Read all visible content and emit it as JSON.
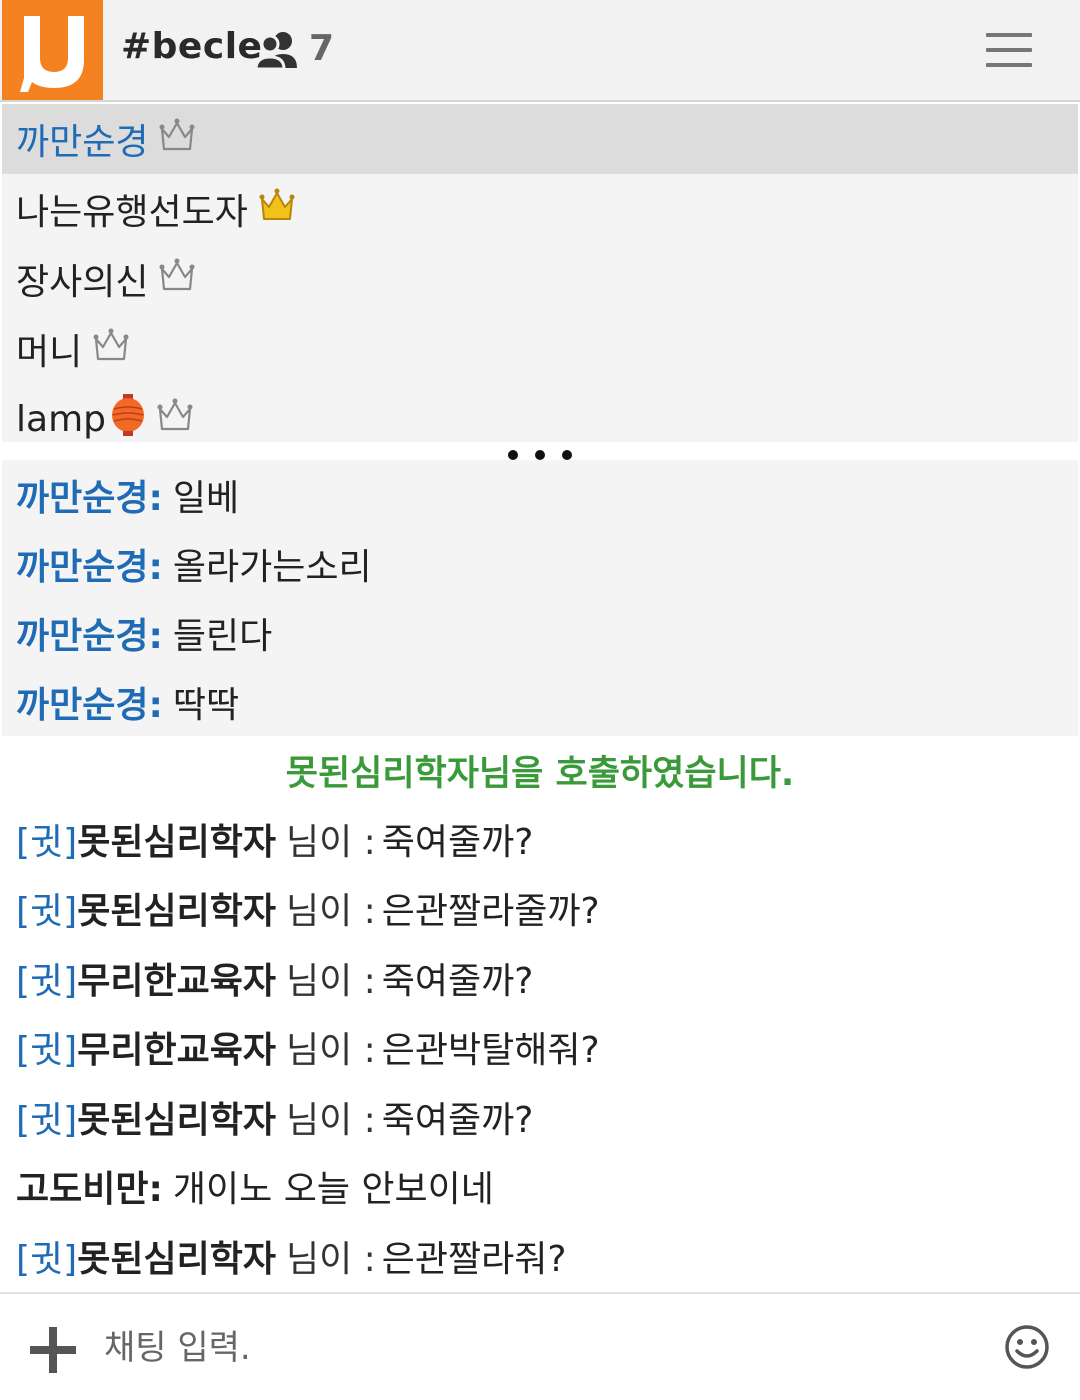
{
  "header": {
    "logo_letter": "U",
    "room_name": "#becle",
    "user_count": "7",
    "brand_color": "#f58220"
  },
  "userlist": [
    {
      "name": "까만순경",
      "crown": "outline",
      "selected": true
    },
    {
      "name": "나는유행선도자",
      "crown": "gold"
    },
    {
      "name": "장사의신",
      "crown": "outline"
    },
    {
      "name": "머니",
      "crown": "outline"
    },
    {
      "name": "lamp",
      "crown": "outline",
      "emoji": "lantern-icon"
    }
  ],
  "chat": {
    "messages": [
      {
        "sender": "까만순경:",
        "text": "일베"
      },
      {
        "sender": "까만순경:",
        "text": "올라가는소리"
      },
      {
        "sender": "까만순경:",
        "text": "들린다"
      },
      {
        "sender": "까만순경:",
        "text": "딱딱"
      }
    ],
    "system_notice": "못된심리학자님을 호출하였습니다.",
    "commands": [
      {
        "tag": "[귓]",
        "nick": "못된심리학자",
        "suffix": "님이 :",
        "text": "죽여줄까?"
      },
      {
        "tag": "[귓]",
        "nick": "못된심리학자",
        "suffix": "님이 :",
        "text": "은관짤라줄까?"
      },
      {
        "tag": "[귓]",
        "nick": "무리한교육자",
        "suffix": "님이 :",
        "text": "죽여줄까?"
      },
      {
        "tag": "[귓]",
        "nick": "무리한교육자",
        "suffix": "님이 :",
        "text": "은관박탈해줘?"
      },
      {
        "tag": "[귓]",
        "nick": "못된심리학자",
        "suffix": "님이 :",
        "text": "죽여줄까?"
      }
    ],
    "last_plain": {
      "sender": "고도비만:",
      "text": "개이노 오늘 안보이네"
    },
    "last_command": {
      "tag": "[귓]",
      "nick": "못된심리학자",
      "suffix": "님이 :",
      "text": "은관짤라줘?"
    }
  },
  "input": {
    "placeholder": "채팅 입력."
  },
  "colors": {
    "sender_blue": "#1f6bb5",
    "system_green": "#3a9a3a",
    "crown_gold": "#f2c21a"
  }
}
